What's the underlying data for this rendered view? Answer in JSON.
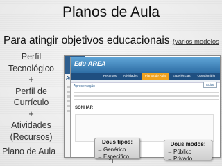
{
  "slide": {
    "title": "Planos de Aula",
    "subtitle": "Para atingir objetivos educacionais",
    "subtitle_note": "(vários modelos",
    "profile_lines": [
      "Perfil",
      "Tecnológico",
      "+",
      "Perfil de",
      "Currículo",
      "+",
      "Atividades",
      "(Recursos)"
    ],
    "plan_label": "Plano de Aula",
    "page_number": "11"
  },
  "screenshot": {
    "logo": "Edu-AREA",
    "side_label": "Aula",
    "tabs": [
      "Recursos",
      "Atividades",
      "Planos de Aula",
      "Experiências",
      "Questionário"
    ],
    "active_tab": "Planos de Aula",
    "panel_title": "Apresentação",
    "plan_name": "SONHAR",
    "edit_label": "Editar"
  },
  "callouts": {
    "types": {
      "title": "Dous tipos:",
      "items": [
        "Genérico",
        "Específico"
      ]
    },
    "modes": {
      "title": "Dous modos:",
      "items": [
        "Público",
        "Privado"
      ]
    }
  }
}
